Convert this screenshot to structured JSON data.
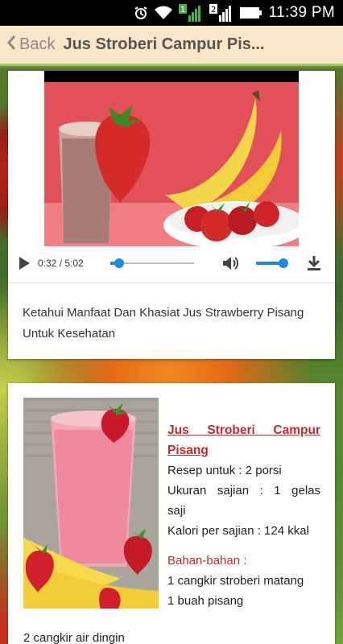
{
  "status_bar": {
    "time": "11:39 PM",
    "sim1": "1",
    "sim2": "2",
    "icons": [
      "alarm-icon",
      "wifi-icon",
      "signal-icon",
      "signal-icon",
      "battery-icon"
    ]
  },
  "action_bar": {
    "back_label": "Back",
    "title": "Jus Stroberi Campur Pis..."
  },
  "player": {
    "time": "0:32 / 5:02",
    "progress": 0.106,
    "volume": 0.85
  },
  "card1": {
    "caption": "Ketahui Manfaat Dan Khasiat Jus Strawberry Pisang Untuk Kesehatan"
  },
  "recipe": {
    "title_line1": "Jus Stroberi Campur",
    "title_line2": "Pisang",
    "servings": "Resep untuk : 2 porsi",
    "size_line1": "Ukuran sajian : 1 gelas",
    "size_line2": "saji",
    "calories": "Kalori per sajian : 124 kkal",
    "ingredients_heading": "Bahan-bahan :",
    "ingredients": [
      "1 cangkir stroberi matang",
      "1 buah pisang",
      "2 cangkir air dingin"
    ]
  },
  "colors": {
    "action_bar_bg": "#fbe5c8",
    "accent_line": "#9ccc65",
    "player_accent": "#1e88e5",
    "recipe_red": "#c62828"
  }
}
